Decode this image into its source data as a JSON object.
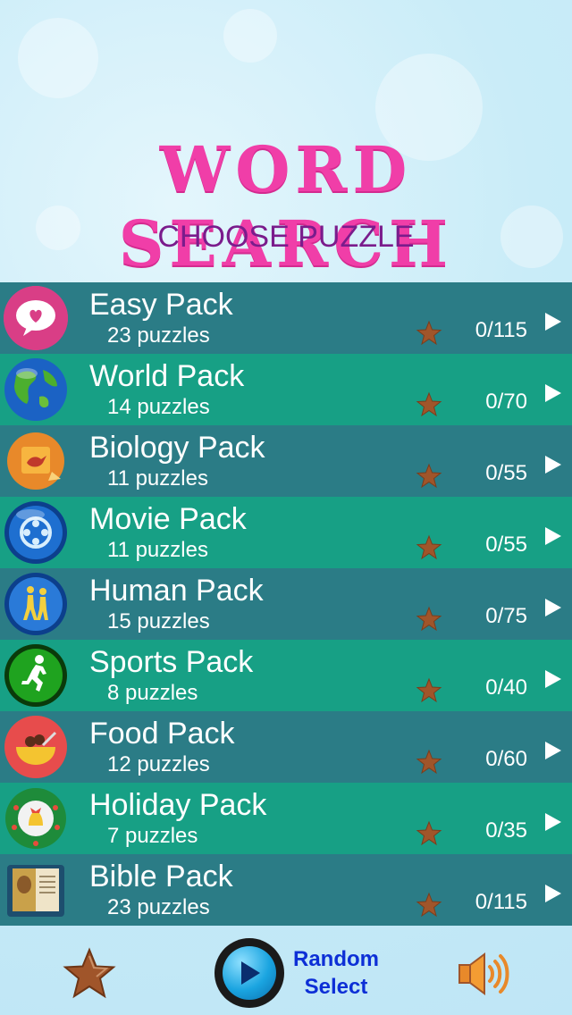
{
  "header": {
    "title": "WORD SEARCH",
    "subtitle": "CHOOSE PUZZLE"
  },
  "packs": [
    {
      "name": "Easy Pack",
      "count": "23 puzzles",
      "score": "0/115",
      "icon": "heart-speech-bubble-icon"
    },
    {
      "name": "World Pack",
      "count": "14 puzzles",
      "score": "0/70",
      "icon": "globe-icon"
    },
    {
      "name": "Biology Pack",
      "count": "11 puzzles",
      "score": "0/55",
      "icon": "bird-sticker-icon"
    },
    {
      "name": "Movie Pack",
      "count": "11 puzzles",
      "score": "0/55",
      "icon": "film-reel-icon"
    },
    {
      "name": "Human Pack",
      "count": "15 puzzles",
      "score": "0/75",
      "icon": "people-walking-icon"
    },
    {
      "name": "Sports Pack",
      "count": "8 puzzles",
      "score": "0/40",
      "icon": "runner-icon"
    },
    {
      "name": "Food Pack",
      "count": "12 puzzles",
      "score": "0/60",
      "icon": "food-bowl-icon"
    },
    {
      "name": "Holiday Pack",
      "count": "7 puzzles",
      "score": "0/35",
      "icon": "christmas-wreath-icon"
    },
    {
      "name": "Bible Pack",
      "count": "23 puzzles",
      "score": "0/115",
      "icon": "bible-book-icon"
    }
  ],
  "footer": {
    "random_line1": "Random",
    "random_line2": "Select"
  },
  "colors": {
    "title": "#f03ea8",
    "subtitle": "#7a1c8c",
    "row_dark": "#2b7c86",
    "row_light": "#17a085",
    "star": "#a0552a",
    "random_text": "#0d2fd6"
  }
}
